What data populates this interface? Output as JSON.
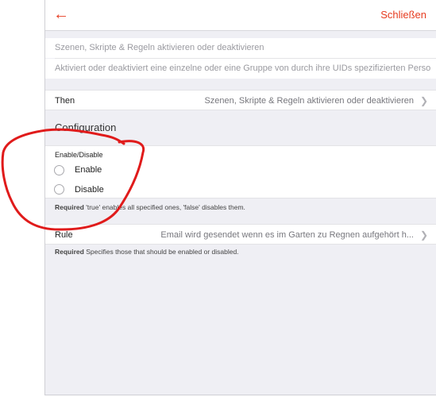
{
  "nav": {
    "back_icon": "arrow-left-icon",
    "close_label": "Schließen",
    "accent": "#e63b1f"
  },
  "name_field": {
    "placeholder": "Szenen, Skripte & Regeln aktivieren oder deaktivieren"
  },
  "description_field": {
    "placeholder": "Aktiviert oder deaktiviert eine einzelne oder eine Gruppe von durch ihre UIDs spezifizierten Perso"
  },
  "then_row": {
    "label": "Then",
    "value": "Szenen, Skripte & Regeln aktivieren oder deaktivieren"
  },
  "configuration": {
    "title": "Configuration",
    "enable_disable": {
      "label": "Enable/Disable",
      "options": [
        "Enable",
        "Disable"
      ],
      "help_required": "Required",
      "help_text": "'true' enables all specified ones, 'false' disables them."
    },
    "rule_row": {
      "label": "Rule",
      "value": "Email wird gesendet wenn es im Garten zu Regnen aufgehört h...",
      "help_required": "Required",
      "help_text": "Specifies those that should be enabled or disabled."
    }
  },
  "annotation": {
    "color": "#e01b1b"
  }
}
